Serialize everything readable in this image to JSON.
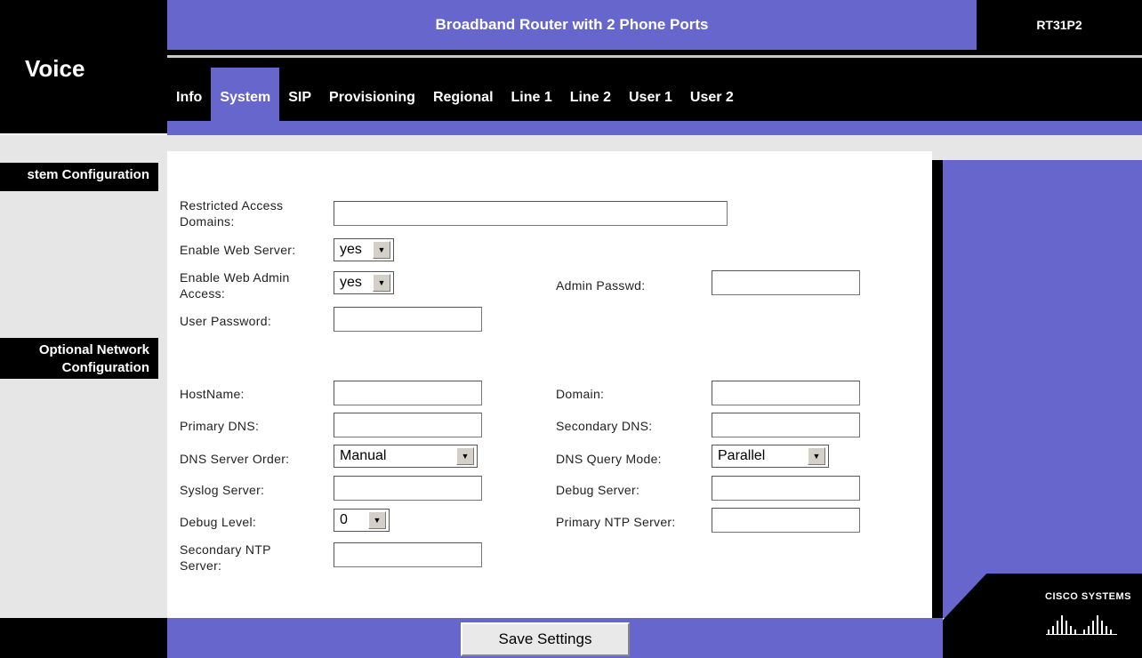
{
  "header": {
    "title": "Broadband Router with 2 Phone Ports",
    "model": "RT31P2",
    "brand": "Voice"
  },
  "tabs": [
    {
      "label": "Info"
    },
    {
      "label": "System"
    },
    {
      "label": "SIP"
    },
    {
      "label": "Provisioning"
    },
    {
      "label": "Regional"
    },
    {
      "label": "Line 1"
    },
    {
      "label": "Line 2"
    },
    {
      "label": "User 1"
    },
    {
      "label": "User 2"
    }
  ],
  "active_tab": "System",
  "sections": {
    "system_config": "stem Configuration",
    "optional_network_line1": "Optional Network",
    "optional_network_line2": "Configuration"
  },
  "form": {
    "restricted_access_domains": {
      "label_line1": "Restricted Access",
      "label_line2": "Domains:",
      "value": ""
    },
    "enable_web_server": {
      "label": "Enable Web Server:",
      "value": "yes"
    },
    "enable_web_admin": {
      "label_line1": "Enable Web Admin",
      "label_line2": "Access:",
      "value": "yes"
    },
    "admin_passwd": {
      "label": "Admin Passwd:",
      "value": ""
    },
    "user_password": {
      "label": "User Password:",
      "value": ""
    },
    "hostname": {
      "label": "HostName:",
      "value": ""
    },
    "domain": {
      "label": "Domain:",
      "value": ""
    },
    "primary_dns": {
      "label": "Primary DNS:",
      "value": ""
    },
    "secondary_dns": {
      "label": "Secondary DNS:",
      "value": ""
    },
    "dns_server_order": {
      "label": "DNS Server Order:",
      "value": "Manual"
    },
    "dns_query_mode": {
      "label": "DNS Query Mode:",
      "value": "Parallel"
    },
    "syslog_server": {
      "label": "Syslog Server:",
      "value": ""
    },
    "debug_server": {
      "label": "Debug Server:",
      "value": ""
    },
    "debug_level": {
      "label": "Debug Level:",
      "value": "0"
    },
    "primary_ntp": {
      "label": "Primary NTP Server:",
      "value": ""
    },
    "secondary_ntp": {
      "label_line1": "Secondary NTP",
      "label_line2": "Server:",
      "value": ""
    }
  },
  "buttons": {
    "save": "Save Settings"
  },
  "logo": {
    "text": "Cisco Systems"
  },
  "colors": {
    "accent_purple": "#6666cc",
    "black": "#000000",
    "panel_gray": "#e6e6e6"
  },
  "icons": {
    "select_arrow": "chevron-down-icon",
    "logo": "cisco-bridge-icon"
  }
}
